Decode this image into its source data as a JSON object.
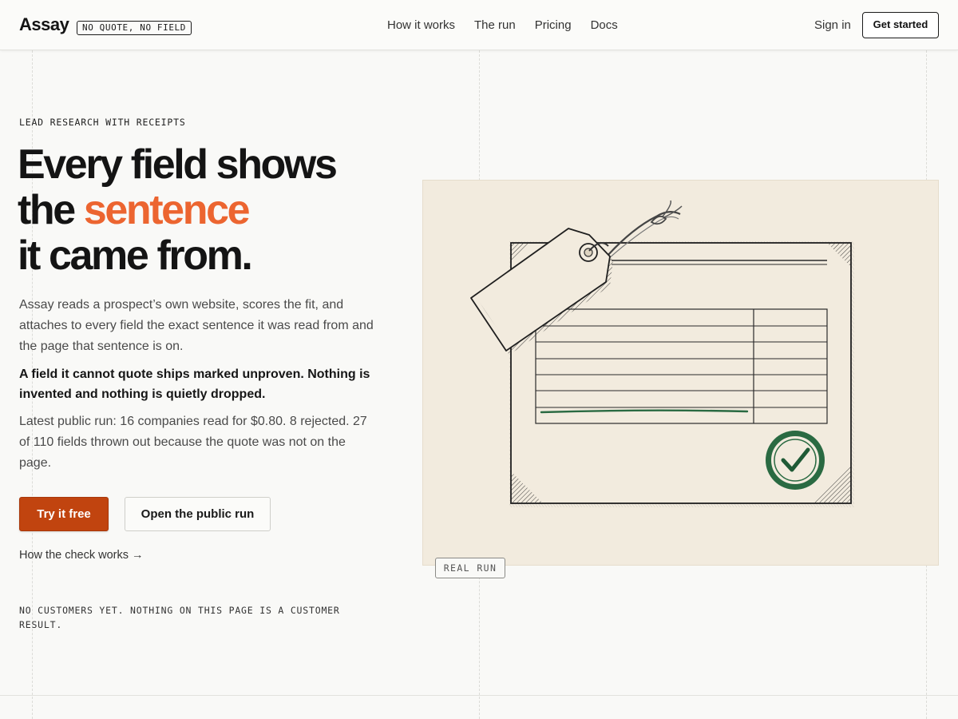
{
  "header": {
    "logo": "Assay",
    "badge": "NO QUOTE, NO FIELD",
    "nav": [
      "How it works",
      "The run",
      "Pricing",
      "Docs"
    ],
    "signin": "Sign in",
    "cta": "Get started"
  },
  "hero": {
    "eyebrow": "LEAD RESEARCH WITH RECEIPTS",
    "headline_line1": "Every field shows",
    "headline_the": "the ",
    "headline_accent": "sentence",
    "headline_line3": "it came from.",
    "paragraph1": "Assay reads a prospect’s own website, scores the fit, and attaches to every field the exact sentence it was read from and the page that sentence is on.",
    "paragraph2": "A field it cannot quote ships marked unproven. Nothing is invented and nothing is quietly dropped.",
    "paragraph3": "Latest public run: 16 companies read for $0.80. 8 rejected. 27 of 110 fields thrown out because the quote was not on the page.",
    "primary_button": "Try it free",
    "secondary_button": "Open the public run",
    "link": "How the check works →",
    "disclaimer": "NO CUSTOMERS YET. NOTHING ON THIS PAGE IS A CUSTOMER RESULT."
  },
  "illustration": {
    "badge": "REAL RUN",
    "icons": [
      "price-tag-icon",
      "document-table-icon",
      "verified-seal-icon"
    ]
  },
  "colors": {
    "accent": "#ec6530",
    "primary_button": "#c1440f",
    "seal": "#2a6a42",
    "illustration_bg": "#f2ebde"
  }
}
